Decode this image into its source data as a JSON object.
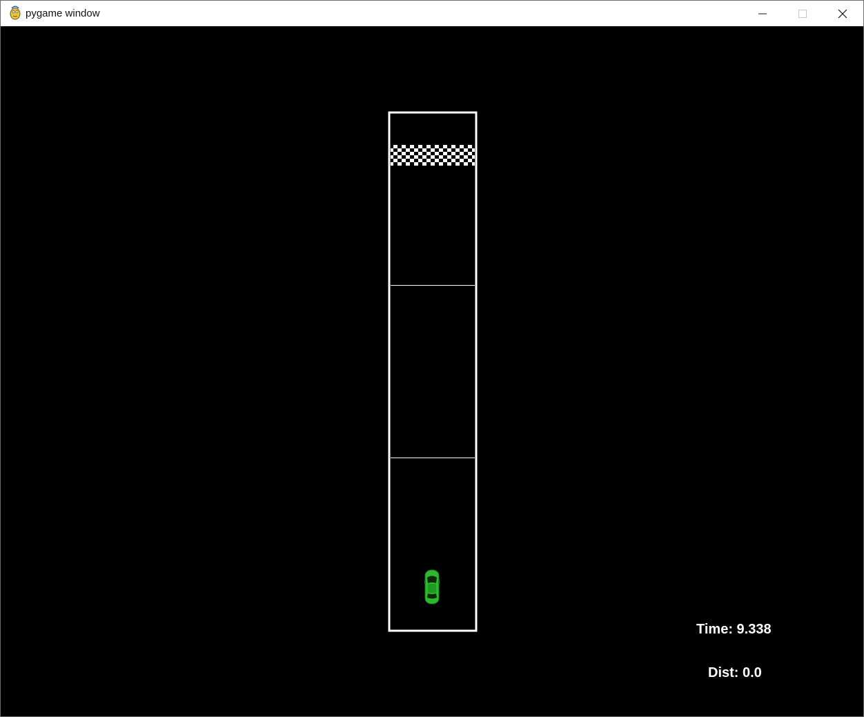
{
  "window": {
    "title": "pygame window",
    "icon": "pygame-snake-icon",
    "controls": {
      "minimize_icon": "minimize-icon",
      "maximize_icon": "maximize-icon",
      "close_icon": "close-icon"
    }
  },
  "game": {
    "background_color": "#000000",
    "track_color": "#ffffff",
    "car_color": "#2db82d",
    "finish_line": "checkered",
    "hud": {
      "time_label": "Time: ",
      "time_value": "9.338",
      "dist_label": "Dist: ",
      "dist_value": "0.0"
    }
  }
}
